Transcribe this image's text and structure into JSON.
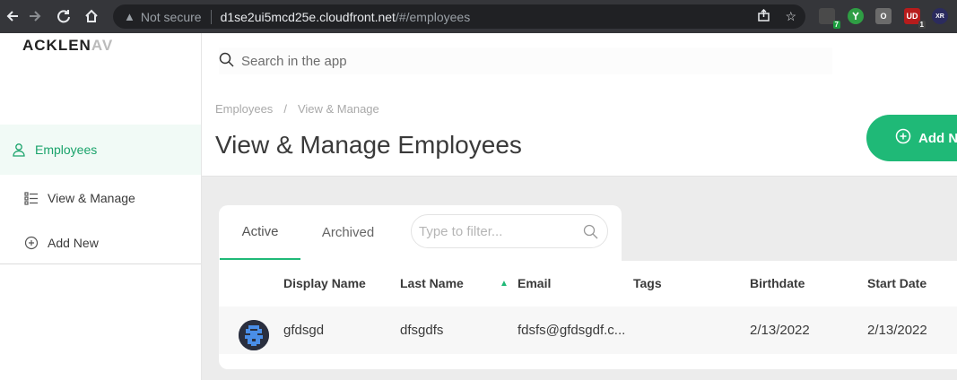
{
  "browser": {
    "security": "Not secure",
    "host": "d1se2ui5mcd25e.cloudfront.net",
    "path": "/#/employees",
    "extensions": [
      {
        "name": "ext-1",
        "badge": "7",
        "color": "#4a4a4a",
        "badge_color": "#1b9e3e"
      },
      {
        "name": "ext-2",
        "badge": "",
        "color": "#2f9e44",
        "badge_color": ""
      },
      {
        "name": "ext-3",
        "badge": "",
        "color": "#6b6b6b",
        "badge_color": ""
      },
      {
        "name": "ext-4",
        "badge": "1",
        "color": "#b71c1c",
        "badge_color": "#444"
      },
      {
        "name": "ext-5",
        "badge": "",
        "color": "#2b2b5e",
        "badge_color": ""
      }
    ],
    "ext_labels": [
      "",
      "",
      "O",
      "UD",
      "XR"
    ]
  },
  "sidebar": {
    "logo_main": "ACKLEN",
    "logo_fade": "AV",
    "items": [
      {
        "label": "Employees",
        "icon": "user-icon",
        "active": true
      },
      {
        "label": "View & Manage",
        "icon": "list-icon",
        "active": false
      },
      {
        "label": "Add New",
        "icon": "plus-circle-icon",
        "active": false
      }
    ]
  },
  "search": {
    "placeholder": "Search in the app"
  },
  "breadcrumb": {
    "items": [
      "Employees",
      "View & Manage"
    ],
    "separator": "/"
  },
  "page": {
    "title": "View & Manage Employees",
    "add_button": "Add New"
  },
  "tabs": [
    {
      "label": "Active",
      "active": true
    },
    {
      "label": "Archived",
      "active": false
    }
  ],
  "filter": {
    "placeholder": "Type to filter..."
  },
  "table": {
    "columns": [
      "Display Name",
      "Last Name",
      "Email",
      "Tags",
      "Birthdate",
      "Start Date"
    ],
    "sort_indicator": "▲",
    "rows": [
      {
        "display_name": "gfdsgd",
        "last_name": "dfsgdfs",
        "email": "fdsfs@gfdsgdf.c...",
        "tags": "",
        "birthdate": "2/13/2022",
        "start_date": "2/13/2022"
      }
    ]
  },
  "colors": {
    "accent": "#1fb977",
    "active_bg": "#f1faf6"
  }
}
